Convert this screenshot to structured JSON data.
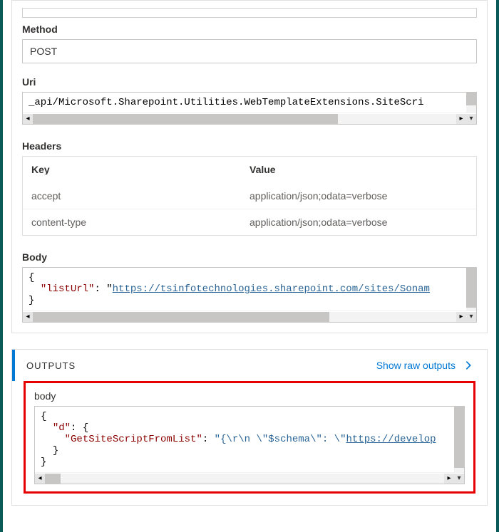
{
  "inputs": {
    "method": {
      "label": "Method",
      "value": "POST"
    },
    "uri": {
      "label": "Uri",
      "value": "_api/Microsoft.Sharepoint.Utilities.WebTemplateExtensions.SiteScri"
    },
    "headers": {
      "label": "Headers",
      "keyHeader": "Key",
      "valueHeader": "Value",
      "rows": [
        {
          "k": "accept",
          "v": "application/json;odata=verbose"
        },
        {
          "k": "content-type",
          "v": "application/json;odata=verbose"
        }
      ]
    },
    "body": {
      "label": "Body",
      "lines": {
        "open": "{",
        "kv_key": "\"listUrl\"",
        "kv_sep": ": ",
        "kv_link_prefix": "\"",
        "kv_link": "https://tsinfotechnologies.sharepoint.com/sites/Sonam",
        "close": "}"
      }
    }
  },
  "outputs": {
    "title": "OUTPUTS",
    "rawLink": "Show raw outputs",
    "body": {
      "label": "body",
      "json": {
        "open": "{",
        "d_key": "\"d\"",
        "d_open": ": {",
        "inner_key": "\"GetSiteScriptFromList\"",
        "inner_sep": ": ",
        "inner_val_prefix": "\"{\\r\\n  \\\"$schema\\\": \\\"",
        "inner_link": "https://develop",
        "d_close": "}",
        "close": "}"
      }
    }
  }
}
